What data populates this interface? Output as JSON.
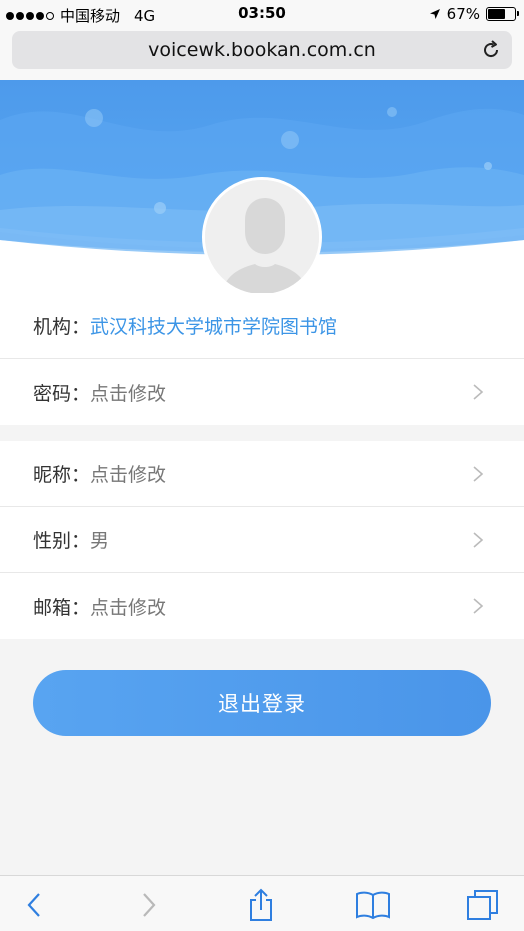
{
  "status_bar": {
    "carrier": "中国移动",
    "network": "4G",
    "time": "03:50",
    "battery_percent": "67%",
    "battery_level": 0.67
  },
  "browser": {
    "url": "voicewk.bookan.com.cn",
    "icons": [
      "reload-icon",
      "back-icon",
      "forward-icon",
      "share-icon",
      "bookmarks-icon",
      "tabs-icon"
    ]
  },
  "profile": {
    "avatar_icon": "default-avatar-icon",
    "groups": [
      {
        "rows": [
          {
            "label": "机构：",
            "value": "武汉科技大学城市学院图书馆",
            "link": true,
            "chevron": false
          },
          {
            "label": "密码：",
            "value": "点击修改",
            "link": false,
            "chevron": true
          }
        ]
      },
      {
        "rows": [
          {
            "label": "昵称：",
            "value": "点击修改",
            "link": false,
            "chevron": true
          },
          {
            "label": "性别：",
            "value": "男",
            "link": false,
            "chevron": true
          },
          {
            "label": "邮箱：",
            "value": "点击修改",
            "link": false,
            "chevron": true
          }
        ]
      }
    ]
  },
  "logout_label": "退出登录",
  "colors": {
    "accent": "#4a95e9",
    "link": "#3c95e6",
    "header_blue": "#4f9cec"
  }
}
